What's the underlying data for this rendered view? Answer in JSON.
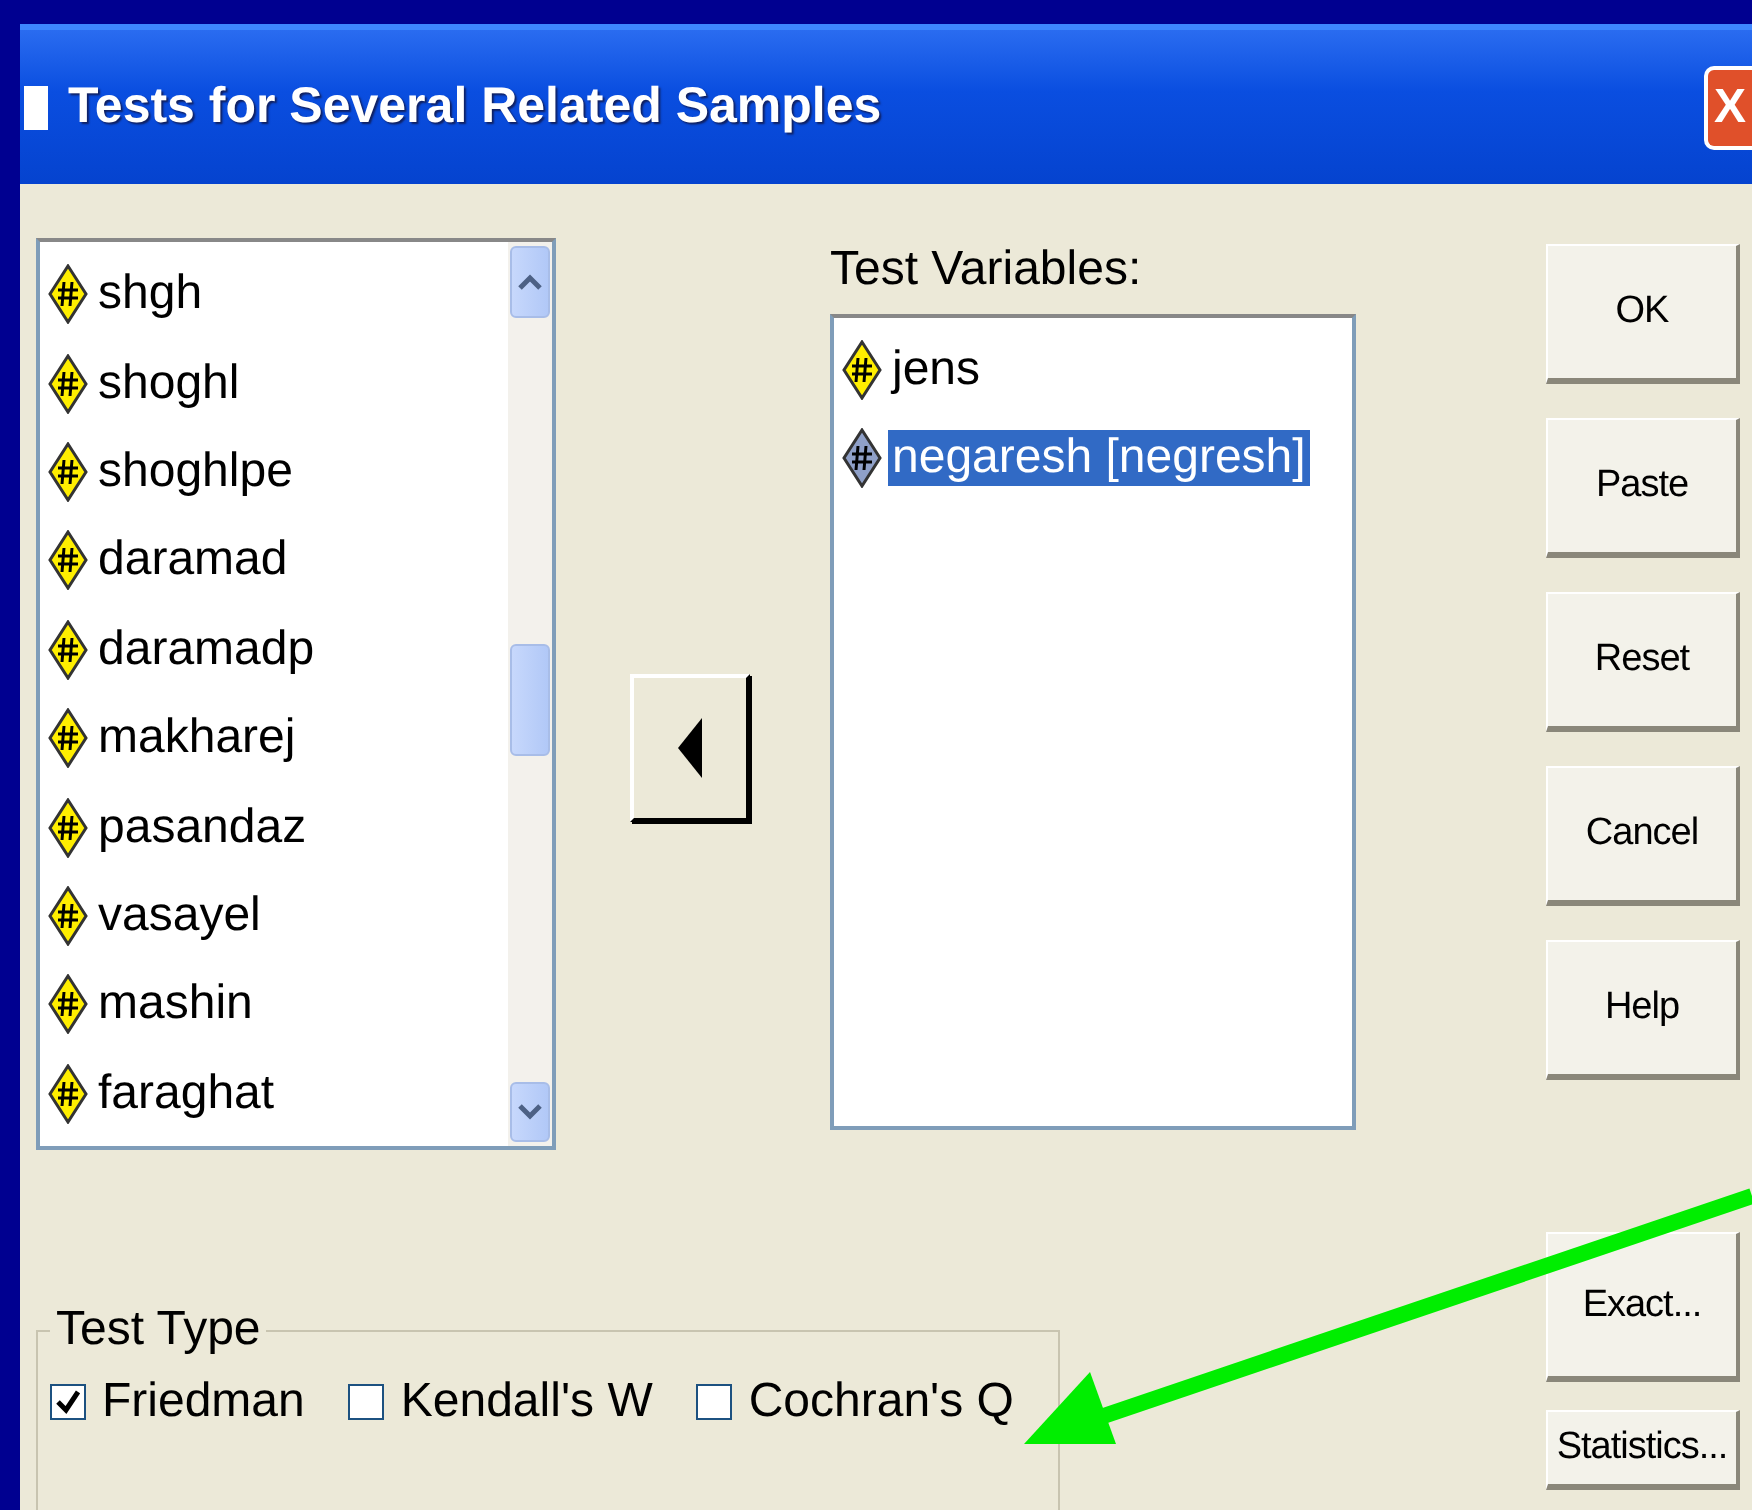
{
  "window": {
    "title": "Tests for Several Related Samples",
    "close_label": "X"
  },
  "source_list": {
    "items": [
      {
        "name": "shgh",
        "selected": false
      },
      {
        "name": "shoghl",
        "selected": false
      },
      {
        "name": "shoghlpe",
        "selected": false
      },
      {
        "name": "daramad",
        "selected": false
      },
      {
        "name": "daramadp",
        "selected": false
      },
      {
        "name": "makharej",
        "selected": false
      },
      {
        "name": "pasandaz",
        "selected": false
      },
      {
        "name": "vasayel",
        "selected": false
      },
      {
        "name": "mashin",
        "selected": false
      },
      {
        "name": "faraghat",
        "selected": false
      }
    ]
  },
  "test_variables": {
    "label": "Test Variables:",
    "items": [
      {
        "name": "jens",
        "selected": false
      },
      {
        "name": "negaresh [negresh]",
        "selected": true
      }
    ]
  },
  "buttons": [
    "OK",
    "Paste",
    "Reset",
    "Cancel",
    "Help",
    "Exact...",
    "Statistics..."
  ],
  "test_type": {
    "title": "Test Type",
    "options": [
      {
        "label": "Friedman",
        "checked": true
      },
      {
        "label": "Kendall's W",
        "checked": false
      },
      {
        "label": "Cochran's Q",
        "checked": false
      }
    ]
  }
}
